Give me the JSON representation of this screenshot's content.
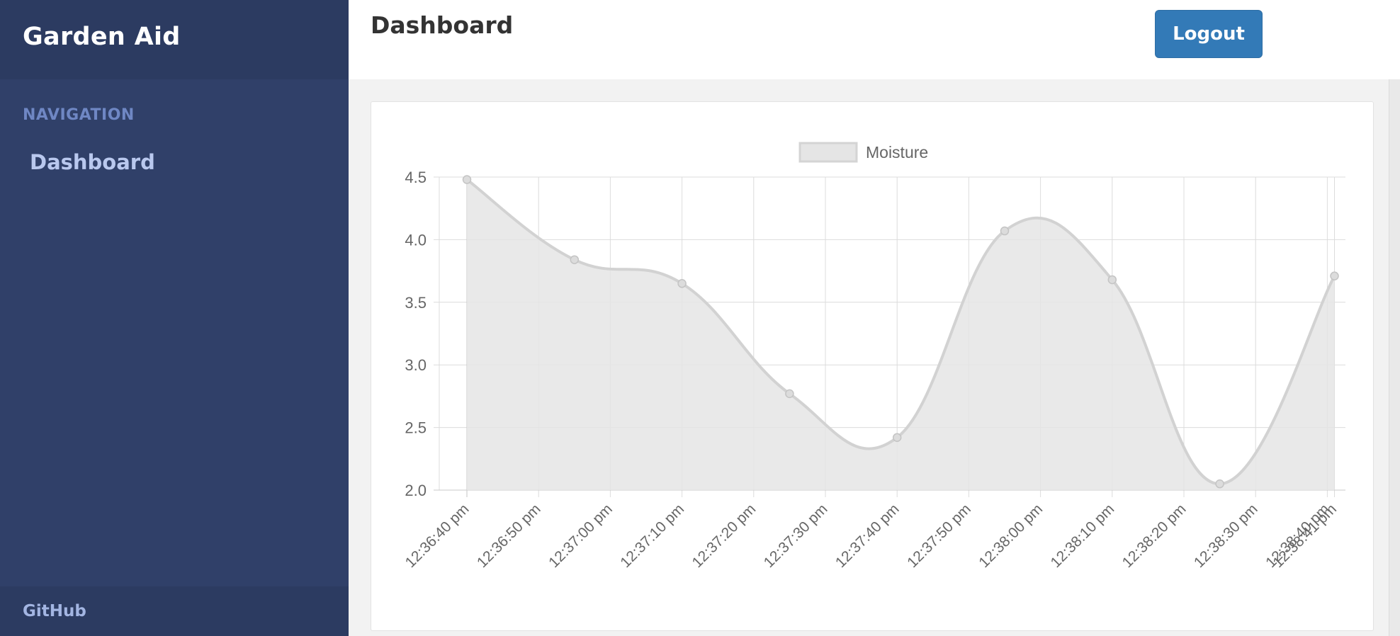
{
  "sidebar": {
    "brand": "Garden Aid",
    "nav_heading": "NAVIGATION",
    "items": [
      {
        "label": "Dashboard"
      }
    ],
    "footer_link": "GitHub"
  },
  "header": {
    "title": "Dashboard",
    "logout_label": "Logout"
  },
  "colors": {
    "sidebar": "#304069",
    "sidebar_header": "#2c3b61",
    "button": "#337ab7",
    "series_fill": "#e5e5e5",
    "series_line": "#d2d2d2",
    "grid": "#dcdcdc"
  },
  "chart_data": {
    "type": "line",
    "legend": [
      "Moisture"
    ],
    "legend_position": "top",
    "grid": true,
    "area_fill": true,
    "ylim": [
      2.0,
      4.5
    ],
    "yticks": [
      "4.5",
      "4.0",
      "3.5",
      "3.0",
      "2.5",
      "2.0"
    ],
    "xticks": [
      "12:36:40 pm",
      "12:36:50 pm",
      "12:37:00 pm",
      "12:37:10 pm",
      "12:37:20 pm",
      "12:37:30 pm",
      "12:37:40 pm",
      "12:37:50 pm",
      "12:38:00 pm",
      "12:38:10 pm",
      "12:38:20 pm",
      "12:38:30 pm",
      "12:38:40 pm",
      "12:38:41 pm"
    ],
    "series": [
      {
        "name": "Moisture",
        "points": [
          {
            "x": "12:36:40 pm",
            "y": 4.48
          },
          {
            "x": "12:36:55 pm",
            "y": 3.84
          },
          {
            "x": "12:37:10 pm",
            "y": 3.65
          },
          {
            "x": "12:37:25 pm",
            "y": 2.77
          },
          {
            "x": "12:37:40 pm",
            "y": 2.42
          },
          {
            "x": "12:37:55 pm",
            "y": 4.07
          },
          {
            "x": "12:38:10 pm",
            "y": 3.68
          },
          {
            "x": "12:38:25 pm",
            "y": 2.05
          },
          {
            "x": "12:38:41 pm",
            "y": 3.71
          }
        ]
      }
    ]
  }
}
